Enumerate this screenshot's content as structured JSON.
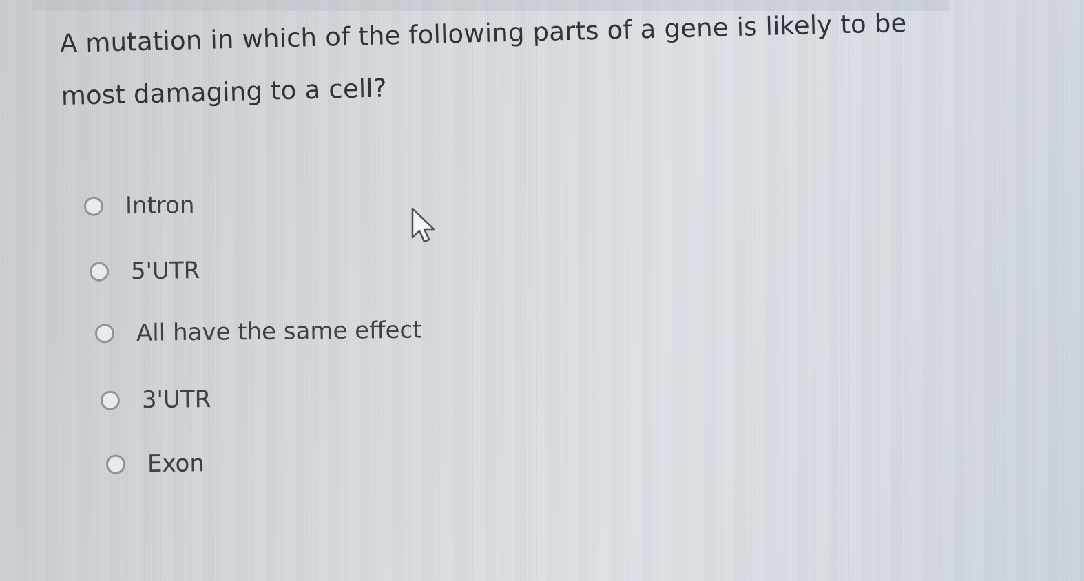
{
  "question": {
    "text": "A mutation in which of the following parts of a gene is likely to be most damaging to a cell?"
  },
  "options": [
    {
      "label": "Intron",
      "selected": false
    },
    {
      "label": "5'UTR",
      "selected": false
    },
    {
      "label": "All have the same effect",
      "selected": false
    },
    {
      "label": "3'UTR",
      "selected": false
    },
    {
      "label": "Exon",
      "selected": false
    }
  ],
  "cursor": {
    "icon": "arrow-pointer-icon"
  },
  "colors": {
    "text": "#2f343a",
    "radio_border": "#8d949b",
    "background": "#d6dade"
  }
}
